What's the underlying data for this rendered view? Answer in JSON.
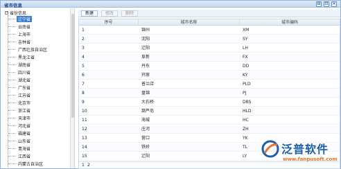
{
  "window": {
    "title": "省市信息",
    "buttons": [
      "⊟",
      "⊡",
      "✕"
    ]
  },
  "tree": {
    "root_label": "省份信息",
    "expander": "−",
    "items": [
      {
        "label": "辽宁省",
        "selected": true
      },
      {
        "label": "云南省",
        "selected": false
      },
      {
        "label": "上海市",
        "selected": false
      },
      {
        "label": "吉林省",
        "selected": false
      },
      {
        "label": "广西壮族自治区",
        "selected": false
      },
      {
        "label": "黑龙江省",
        "selected": false
      },
      {
        "label": "湖南省",
        "selected": false
      },
      {
        "label": "四川省",
        "selected": false
      },
      {
        "label": "湖北省",
        "selected": false
      },
      {
        "label": "广东省",
        "selected": false
      },
      {
        "label": "江苏省",
        "selected": false
      },
      {
        "label": "北京市",
        "selected": false
      },
      {
        "label": "浙江省",
        "selected": false
      },
      {
        "label": "天津市",
        "selected": false
      },
      {
        "label": "河北省",
        "selected": false
      },
      {
        "label": "福建省",
        "selected": false
      },
      {
        "label": "山东省",
        "selected": false
      },
      {
        "label": "青海省",
        "selected": false
      },
      {
        "label": "江西省",
        "selected": false
      },
      {
        "label": "内蒙古自治区",
        "selected": false
      }
    ]
  },
  "toolbar": {
    "new_label": "新建",
    "edit_label": "修改",
    "delete_label": "删除"
  },
  "grid": {
    "columns": [
      "序号",
      "城市名称",
      "城市编码"
    ],
    "rows": [
      [
        "1",
        "锦州",
        "XM"
      ],
      [
        "2",
        "沈阳",
        "SY"
      ],
      [
        "3",
        "辽阳",
        "LH"
      ],
      [
        "4",
        "阜新",
        "FX"
      ],
      [
        "5",
        "丹东",
        "DD"
      ],
      [
        "6",
        "开原",
        "KY"
      ],
      [
        "7",
        "普兰店",
        "PLD"
      ],
      [
        "8",
        "盘锦",
        "PJ"
      ],
      [
        "9",
        "大石桥",
        "DBS"
      ],
      [
        "10",
        "葫芦岛",
        "HLD"
      ],
      [
        "11",
        "海城",
        "HC"
      ],
      [
        "12",
        "庄河",
        "ZH"
      ],
      [
        "13",
        "营口",
        "YK"
      ],
      [
        "14",
        "铁岭",
        "TL"
      ],
      [
        "15",
        "辽阳",
        "LY"
      ]
    ],
    "pager": [
      "1",
      "2"
    ]
  },
  "watermark": {
    "brand": "泛普软件",
    "url": "www.fanpusoft.com"
  },
  "colors": {
    "title_text": "#15428b",
    "selection": "#3c7fd1",
    "border": "#8db2e3",
    "brand_blue": "#1c5fa8",
    "brand_orange": "#e8732a"
  }
}
